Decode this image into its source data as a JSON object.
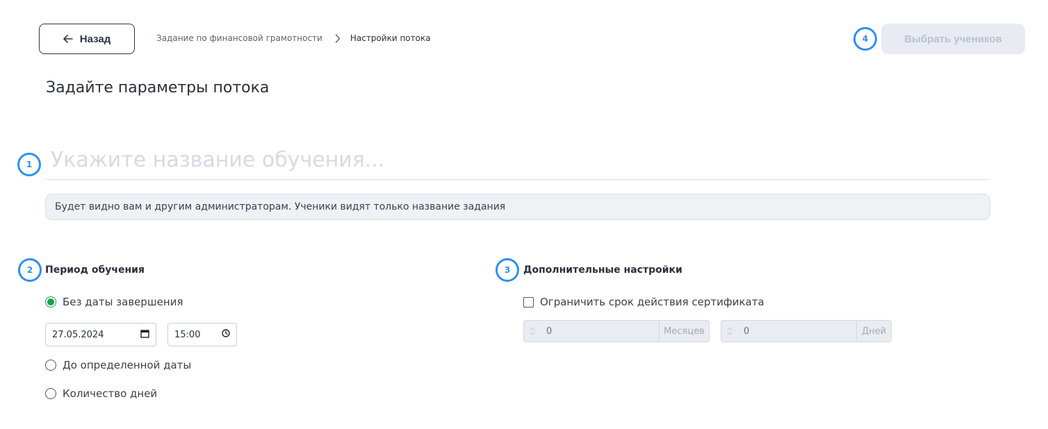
{
  "header": {
    "back_label": "Назад",
    "breadcrumb": [
      "Задание по финансовой грамотности",
      "Настройки потока"
    ],
    "select_students_label": "Выбрать учеников"
  },
  "steps": [
    "1",
    "2",
    "3",
    "4"
  ],
  "page_title": "Задайте параметры потока",
  "name_field": {
    "placeholder": "Укажите название обучения...",
    "value": "",
    "hint": "Будет видно вам и другим администраторам. Ученики видят только название задания"
  },
  "period": {
    "title": "Период обучения",
    "options": [
      {
        "label": "Без даты завершения",
        "checked": true
      },
      {
        "label": "До определенной даты",
        "checked": false
      },
      {
        "label": "Количество дней",
        "checked": false
      }
    ],
    "date": "27.05.2024",
    "time": "15:00"
  },
  "extra": {
    "title": "Дополнительные настройки",
    "limit_certificate_label": "Ограничить срок действия сертификата",
    "limit_certificate_checked": false,
    "months": {
      "value": "0",
      "unit": "Месяцев"
    },
    "days": {
      "value": "0",
      "unit": "Дней"
    }
  },
  "colors": {
    "accent": "#2f8ff0",
    "radio_checked": "#16a34a",
    "disabled_bg": "#e8ebf2",
    "disabled_text": "#b9c1d0"
  }
}
